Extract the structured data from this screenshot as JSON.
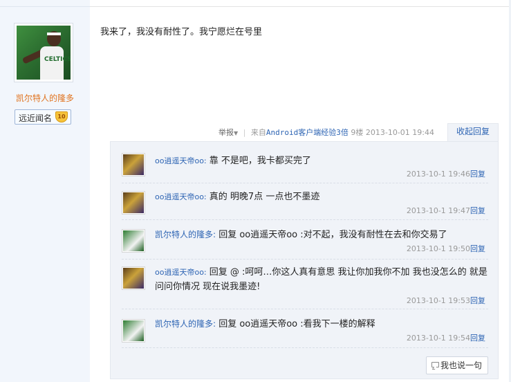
{
  "author": {
    "name": "凯尔特人的隆多",
    "rank_label": "远近闻名",
    "level": "10",
    "avatar_icon": "celtics-player-avatar"
  },
  "post": {
    "content": "我来了，我没有耐性了。我宁愿烂在号里"
  },
  "meta": {
    "report_label": "举报",
    "client_prefix": "来自",
    "client_link": "Android客户端经验3倍",
    "floor": "9楼",
    "time": "2013-10-01 19:44",
    "collapse_label": "收起回复"
  },
  "replies": [
    {
      "user": "oo逍遥天帝oo:",
      "text": "靠 不是吧，我卡都买完了",
      "time": "2013-10-1 19:46",
      "reply_label": "回复",
      "avatar_icon": "lakers-player-avatar"
    },
    {
      "user": "oo逍遥天帝oo:",
      "text": "真的 明晚7点 一点也不墨迹",
      "time": "2013-10-1 19:47",
      "reply_label": "回复",
      "avatar_icon": "lakers-player-avatar"
    },
    {
      "user": "凯尔特人的隆多:",
      "text": "回复 oo逍遥天帝oo :对不起，我没有耐性在去和你交易了",
      "time": "2013-10-1 19:50",
      "reply_label": "回复",
      "avatar_icon": "celtics-player-avatar"
    },
    {
      "user": "oo逍遥天帝oo:",
      "text": "回复 @ :呵呵…你这人真有意思 我让你加我你不加 我也没怎么的 就是问问你情况 现在说我墨迹!",
      "time": "2013-10-1 19:53",
      "reply_label": "回复",
      "avatar_icon": "lakers-player-avatar"
    },
    {
      "user": "凯尔特人的隆多:",
      "text": "回复 oo逍遥天帝oo :看我下一楼的解释",
      "time": "2013-10-1 19:54",
      "reply_label": "回复",
      "avatar_icon": "celtics-player-avatar"
    }
  ],
  "say_button_label": "我也说一句",
  "colors": {
    "sidebar_bg": "#f2f6fc",
    "link_blue": "#2d64b3",
    "username_orange": "#e0731f",
    "reply_box_bg": "#f0f3f8"
  }
}
